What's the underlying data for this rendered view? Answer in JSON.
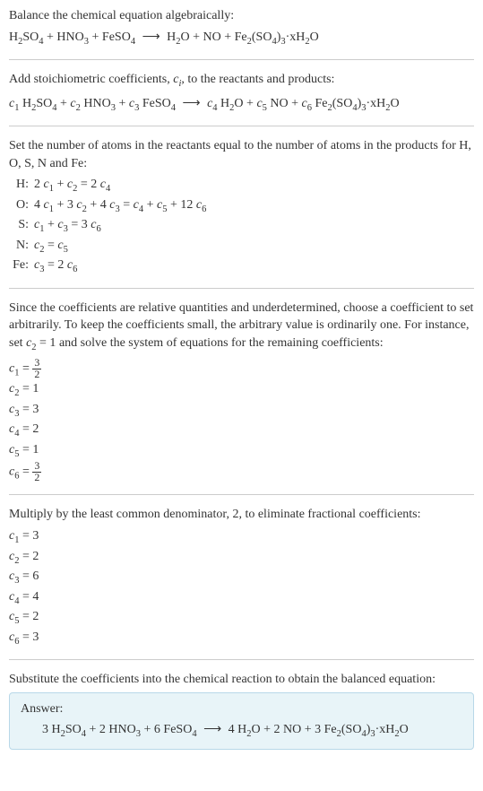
{
  "intro": {
    "line1": "Balance the chemical equation algebraically:",
    "equation": "H₂SO₄ + HNO₃ + FeSO₄ ⟶ H₂O + NO + Fe₂(SO₄)₃·xH₂O"
  },
  "step1": {
    "text_before": "Add stoichiometric coefficients, ",
    "coef_var": "cᵢ",
    "text_after": ", to the reactants and products:",
    "equation_parts": {
      "c1": "c₁",
      "r1": " H₂SO₄ + ",
      "c2": "c₂",
      "r2": " HNO₃ + ",
      "c3": "c₃",
      "r3": " FeSO₄ ⟶ ",
      "c4": "c₄",
      "r4": " H₂O + ",
      "c5": "c₅",
      "r5": " NO + ",
      "c6": "c₆",
      "r6": " Fe₂(SO₄)₃·xH₂O"
    }
  },
  "step2": {
    "text": "Set the number of atoms in the reactants equal to the number of atoms in the products for H, O, S, N and Fe:",
    "rows": [
      {
        "label": "H:",
        "eq": "2 c₁ + c₂ = 2 c₄"
      },
      {
        "label": "O:",
        "eq": "4 c₁ + 3 c₂ + 4 c₃ = c₄ + c₅ + 12 c₆"
      },
      {
        "label": "S:",
        "eq": "c₁ + c₃ = 3 c₆"
      },
      {
        "label": "N:",
        "eq": "c₂ = c₅"
      },
      {
        "label": "Fe:",
        "eq": "c₃ = 2 c₆"
      }
    ]
  },
  "step3": {
    "text_parts": {
      "p1": "Since the coefficients are relative quantities and underdetermined, choose a coefficient to set arbitrarily. To keep the coefficients small, the arbitrary value is ordinarily one. For instance, set ",
      "p2": "c₂ = 1",
      "p3": " and solve the system of equations for the remaining coefficients:"
    },
    "results": [
      {
        "lhs": "c₁ = ",
        "frac_num": "3",
        "frac_den": "2"
      },
      {
        "lhs": "c₂ = ",
        "val": "1"
      },
      {
        "lhs": "c₃ = ",
        "val": "3"
      },
      {
        "lhs": "c₄ = ",
        "val": "2"
      },
      {
        "lhs": "c₅ = ",
        "val": "1"
      },
      {
        "lhs": "c₆ = ",
        "frac_num": "3",
        "frac_den": "2"
      }
    ]
  },
  "step4": {
    "text": "Multiply by the least common denominator, 2, to eliminate fractional coefficients:",
    "results": [
      {
        "eq": "c₁ = 3"
      },
      {
        "eq": "c₂ = 2"
      },
      {
        "eq": "c₃ = 6"
      },
      {
        "eq": "c₄ = 4"
      },
      {
        "eq": "c₅ = 2"
      },
      {
        "eq": "c₆ = 3"
      }
    ]
  },
  "step5": {
    "text": "Substitute the coefficients into the chemical reaction to obtain the balanced equation:"
  },
  "answer": {
    "label": "Answer:",
    "equation": "3 H₂SO₄ + 2 HNO₃ + 6 FeSO₄ ⟶ 4 H₂O + 2 NO + 3 Fe₂(SO₄)₃·xH₂O"
  }
}
